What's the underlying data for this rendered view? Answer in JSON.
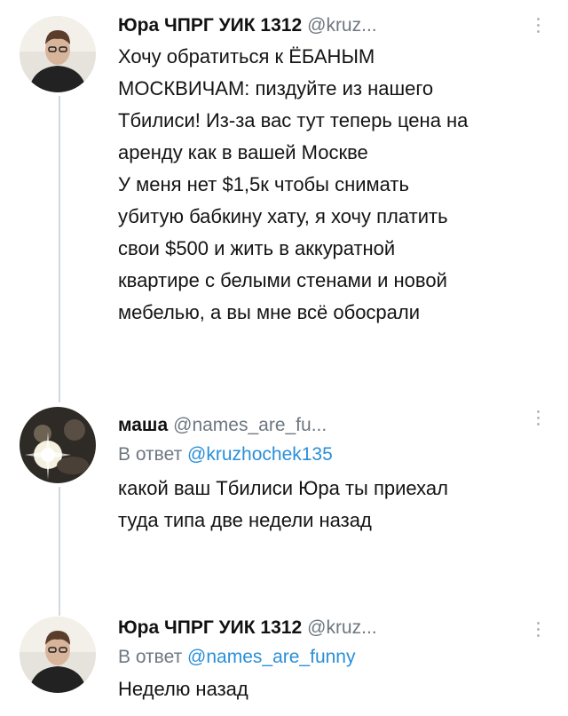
{
  "tweets": [
    {
      "author_name": "Юра ЧПРГ УИК 1312",
      "handle": "@kruz...",
      "reply_prefix": "",
      "reply_handle": "",
      "text": "Хочу обратиться к ЁБАНЫМ\nМОСКВИЧАМ: пиздуйте из нашего\nТбилиси! Из-за вас тут теперь цена на\nаренду как в вашей Москве\nУ меня нет $1,5к чтобы снимать\nубитую бабкину хату, я хочу платить\nсвои $500 и жить в аккуратной\nквартире с белыми стенами и новой\nмебелью, а вы мне всё обосрали"
    },
    {
      "author_name": "маша",
      "handle": "@names_are_fu...",
      "reply_prefix": "В ответ",
      "reply_handle": "@kruzhochek135",
      "text": "какой ваш Тбилиси Юра ты приехал\nтуда типа две недели назад"
    },
    {
      "author_name": "Юра ЧПРГ УИК 1312",
      "handle": "@kruz...",
      "reply_prefix": "В ответ",
      "reply_handle": "@names_are_funny",
      "text": "Неделю назад"
    }
  ],
  "colors": {
    "link": "#2a8fd8",
    "secondary_text": "#6e7781",
    "thread_line": "#cfd9de"
  },
  "icons": {
    "avatar_1": "avatar-icon",
    "menu": "more-vertical-icon"
  }
}
